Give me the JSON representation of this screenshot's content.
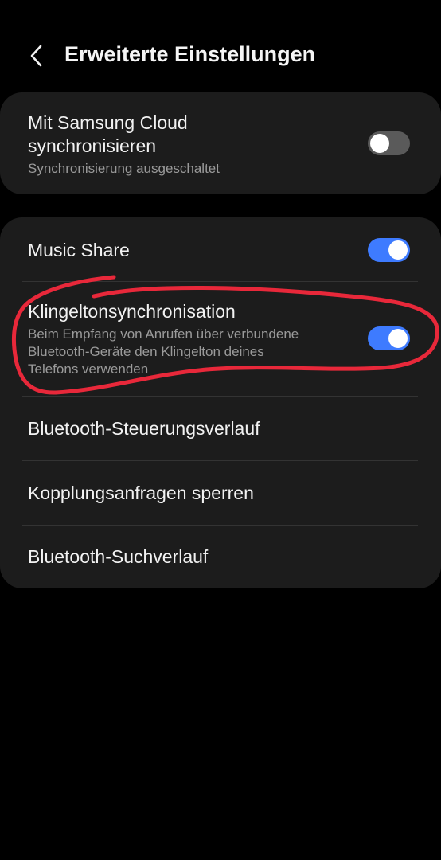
{
  "header": {
    "title": "Erweiterte Einstellungen",
    "back_icon": "chevron-left-icon"
  },
  "samsung_cloud": {
    "title_line1": "Mit Samsung Cloud",
    "title_line2": "synchronisieren",
    "subtitle": "Synchronisierung ausgeschaltet",
    "toggle_state": "off"
  },
  "music_share": {
    "title": "Music Share",
    "toggle_state": "on"
  },
  "ringtone_sync": {
    "title": "Klingeltonsynchronisation",
    "subtitle_line1": "Beim Empfang von Anrufen über verbundene",
    "subtitle_line2": "Bluetooth-Geräte den Klingelton deines",
    "subtitle_line3": "Telefons verwenden",
    "toggle_state": "on"
  },
  "menu_items": [
    "Bluetooth-Steuerungsverlauf",
    "Kopplungsanfragen sperren",
    "Bluetooth-Suchverlauf"
  ],
  "colors": {
    "toggle_on": "#3e7bff",
    "toggle_off": "#5a5a5a",
    "annotation": "#e8283a",
    "card_background": "#1c1c1c"
  }
}
